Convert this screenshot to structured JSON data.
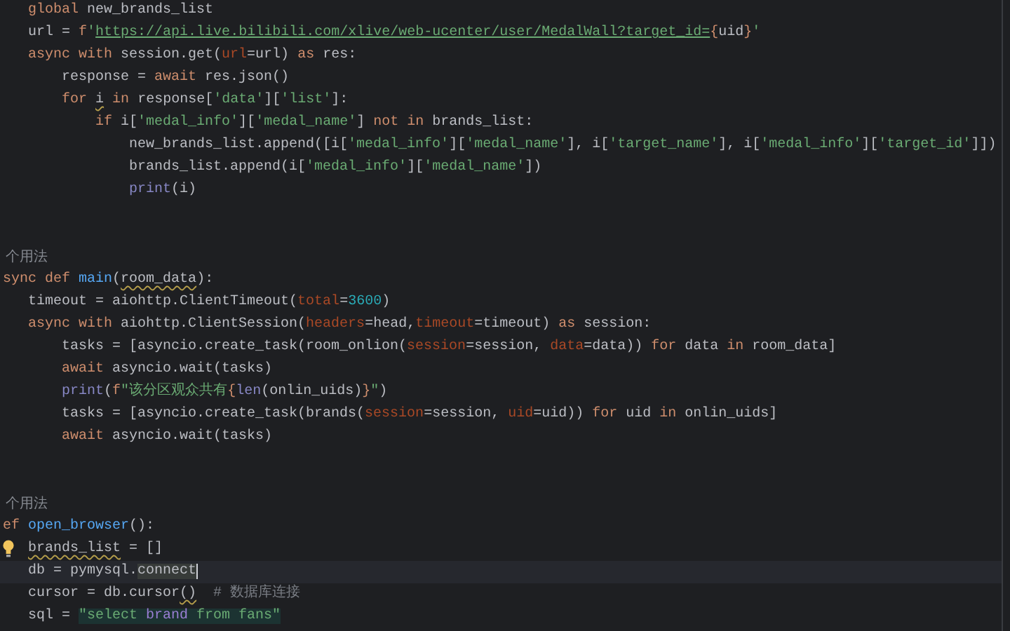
{
  "editor": {
    "lines": [
      {
        "kind": "code",
        "tokens": [
          {
            "kind": "keyword",
            "text": "   global"
          },
          {
            "kind": "plain",
            "text": " new_brands_list"
          }
        ]
      },
      {
        "kind": "code",
        "tokens": [
          {
            "kind": "plain",
            "text": "   url = "
          },
          {
            "kind": "keyword",
            "text": "f"
          },
          {
            "kind": "string",
            "text": "'"
          },
          {
            "kind": "link",
            "text": "https://api.live.bilibili.com/xlive/web-ucenter/user/MedalWall?target_id="
          },
          {
            "kind": "brace",
            "text": "{"
          },
          {
            "kind": "plain",
            "text": "uid"
          },
          {
            "kind": "brace",
            "text": "}"
          },
          {
            "kind": "string",
            "text": "'"
          }
        ]
      },
      {
        "kind": "code",
        "tokens": [
          {
            "kind": "keyword",
            "text": "   async with"
          },
          {
            "kind": "plain",
            "text": " session.get("
          },
          {
            "kind": "param",
            "text": "url"
          },
          {
            "kind": "plain",
            "text": "=url) "
          },
          {
            "kind": "keyword",
            "text": "as"
          },
          {
            "kind": "plain",
            "text": " res:"
          }
        ]
      },
      {
        "kind": "code",
        "tokens": [
          {
            "kind": "plain",
            "text": "       response = "
          },
          {
            "kind": "keyword",
            "text": "await"
          },
          {
            "kind": "plain",
            "text": " res.json()"
          }
        ]
      },
      {
        "kind": "code",
        "tokens": [
          {
            "kind": "keyword",
            "text": "       for"
          },
          {
            "kind": "plain",
            "text": " i",
            "warning": true
          },
          {
            "kind": "keyword",
            "text": " in"
          },
          {
            "kind": "plain",
            "text": " response["
          },
          {
            "kind": "string",
            "text": "'data'"
          },
          {
            "kind": "plain",
            "text": "]["
          },
          {
            "kind": "string",
            "text": "'list'"
          },
          {
            "kind": "plain",
            "text": "]:"
          }
        ]
      },
      {
        "kind": "code",
        "tokens": [
          {
            "kind": "keyword",
            "text": "           if"
          },
          {
            "kind": "plain",
            "text": " i["
          },
          {
            "kind": "string",
            "text": "'medal_info'"
          },
          {
            "kind": "plain",
            "text": "]["
          },
          {
            "kind": "string",
            "text": "'medal_name'"
          },
          {
            "kind": "plain",
            "text": "] "
          },
          {
            "kind": "keyword",
            "text": "not in"
          },
          {
            "kind": "plain",
            "text": " brands_list:"
          }
        ]
      },
      {
        "kind": "code",
        "tokens": [
          {
            "kind": "plain",
            "text": "               new_brands_list.append([i["
          },
          {
            "kind": "string",
            "text": "'medal_info'"
          },
          {
            "kind": "plain",
            "text": "]["
          },
          {
            "kind": "string",
            "text": "'medal_name'"
          },
          {
            "kind": "plain",
            "text": "], i["
          },
          {
            "kind": "string",
            "text": "'target_name'"
          },
          {
            "kind": "plain",
            "text": "], i["
          },
          {
            "kind": "string",
            "text": "'medal_info'"
          },
          {
            "kind": "plain",
            "text": "]["
          },
          {
            "kind": "string",
            "text": "'target_id'"
          },
          {
            "kind": "plain",
            "text": "]])"
          }
        ]
      },
      {
        "kind": "code",
        "tokens": [
          {
            "kind": "plain",
            "text": "               brands_list.append(i["
          },
          {
            "kind": "string",
            "text": "'medal_info'"
          },
          {
            "kind": "plain",
            "text": "]["
          },
          {
            "kind": "string",
            "text": "'medal_name'"
          },
          {
            "kind": "plain",
            "text": "])"
          }
        ]
      },
      {
        "kind": "code",
        "tokens": [
          {
            "kind": "builtin",
            "text": "               print"
          },
          {
            "kind": "plain",
            "text": "(i)"
          }
        ]
      },
      {
        "kind": "blank"
      },
      {
        "kind": "blank"
      },
      {
        "kind": "hint",
        "text": "个用法"
      },
      {
        "kind": "code",
        "tokens": [
          {
            "kind": "keyword",
            "text": "sync def"
          },
          {
            "kind": "func",
            "text": " main"
          },
          {
            "kind": "plain",
            "text": "("
          },
          {
            "kind": "plain",
            "text": "room_data",
            "warning": true
          },
          {
            "kind": "plain",
            "text": "):"
          }
        ]
      },
      {
        "kind": "code",
        "tokens": [
          {
            "kind": "plain",
            "text": "   timeout = aiohttp.ClientTimeout("
          },
          {
            "kind": "param",
            "text": "total"
          },
          {
            "kind": "plain",
            "text": "="
          },
          {
            "kind": "number",
            "text": "3600"
          },
          {
            "kind": "plain",
            "text": ")"
          }
        ]
      },
      {
        "kind": "code",
        "tokens": [
          {
            "kind": "keyword",
            "text": "   async with"
          },
          {
            "kind": "plain",
            "text": " aiohttp.ClientSession("
          },
          {
            "kind": "param",
            "text": "headers"
          },
          {
            "kind": "plain",
            "text": "=head,"
          },
          {
            "kind": "param",
            "text": "timeout"
          },
          {
            "kind": "plain",
            "text": "=timeout) "
          },
          {
            "kind": "keyword",
            "text": "as"
          },
          {
            "kind": "plain",
            "text": " session:"
          }
        ]
      },
      {
        "kind": "code",
        "tokens": [
          {
            "kind": "plain",
            "text": "       tasks = [asyncio.create_task(room_onlion("
          },
          {
            "kind": "param",
            "text": "session"
          },
          {
            "kind": "plain",
            "text": "=session, "
          },
          {
            "kind": "param",
            "text": "data"
          },
          {
            "kind": "plain",
            "text": "=data)) "
          },
          {
            "kind": "keyword",
            "text": "for"
          },
          {
            "kind": "plain",
            "text": " data "
          },
          {
            "kind": "keyword",
            "text": "in"
          },
          {
            "kind": "plain",
            "text": " room_data]"
          }
        ]
      },
      {
        "kind": "code",
        "tokens": [
          {
            "kind": "keyword",
            "text": "       await"
          },
          {
            "kind": "plain",
            "text": " asyncio.wait(tasks)"
          }
        ]
      },
      {
        "kind": "code",
        "tokens": [
          {
            "kind": "builtin",
            "text": "       print"
          },
          {
            "kind": "plain",
            "text": "("
          },
          {
            "kind": "keyword",
            "text": "f"
          },
          {
            "kind": "string",
            "text": "\"该分区观众共有"
          },
          {
            "kind": "brace",
            "text": "{"
          },
          {
            "kind": "builtin",
            "text": "len"
          },
          {
            "kind": "plain",
            "text": "(onlin_uids)"
          },
          {
            "kind": "brace",
            "text": "}"
          },
          {
            "kind": "string",
            "text": "\""
          },
          {
            "kind": "plain",
            "text": ")"
          }
        ]
      },
      {
        "kind": "code",
        "tokens": [
          {
            "kind": "plain",
            "text": "       tasks = [asyncio.create_task(brands("
          },
          {
            "kind": "param",
            "text": "session"
          },
          {
            "kind": "plain",
            "text": "=session, "
          },
          {
            "kind": "param",
            "text": "uid"
          },
          {
            "kind": "plain",
            "text": "=uid)) "
          },
          {
            "kind": "keyword",
            "text": "for"
          },
          {
            "kind": "plain",
            "text": " uid "
          },
          {
            "kind": "keyword",
            "text": "in"
          },
          {
            "kind": "plain",
            "text": " onlin_uids]"
          }
        ]
      },
      {
        "kind": "code",
        "tokens": [
          {
            "kind": "keyword",
            "text": "       await"
          },
          {
            "kind": "plain",
            "text": " asyncio.wait(tasks)"
          }
        ]
      },
      {
        "kind": "blank"
      },
      {
        "kind": "blank"
      },
      {
        "kind": "hint",
        "text": "个用法"
      },
      {
        "kind": "code",
        "tokens": [
          {
            "kind": "keyword",
            "text": "ef"
          },
          {
            "kind": "func",
            "text": " open_browser"
          },
          {
            "kind": "plain",
            "text": "():"
          }
        ]
      },
      {
        "kind": "code",
        "bulb": true,
        "tokens": [
          {
            "kind": "plain",
            "text": "   brands_list",
            "warning": true
          },
          {
            "kind": "plain",
            "text": " = []"
          }
        ]
      },
      {
        "kind": "code",
        "current": true,
        "caret": true,
        "tokens": [
          {
            "kind": "plain",
            "text": "   db = pymysql."
          },
          {
            "kind": "selection",
            "text": "connect"
          }
        ]
      },
      {
        "kind": "code",
        "tokens": [
          {
            "kind": "plain",
            "text": "   cursor = db.cursor"
          },
          {
            "kind": "plain",
            "text": "()",
            "warning": true
          },
          {
            "kind": "comment",
            "text": "  # 数据库连接"
          }
        ]
      },
      {
        "kind": "code",
        "tokens": [
          {
            "kind": "plain",
            "text": "   sql = "
          },
          {
            "kind": "sql",
            "text": "\"select "
          },
          {
            "kind": "sqlcolumn",
            "text": "brand"
          },
          {
            "kind": "sql",
            "text": " from fans\""
          }
        ]
      }
    ]
  }
}
